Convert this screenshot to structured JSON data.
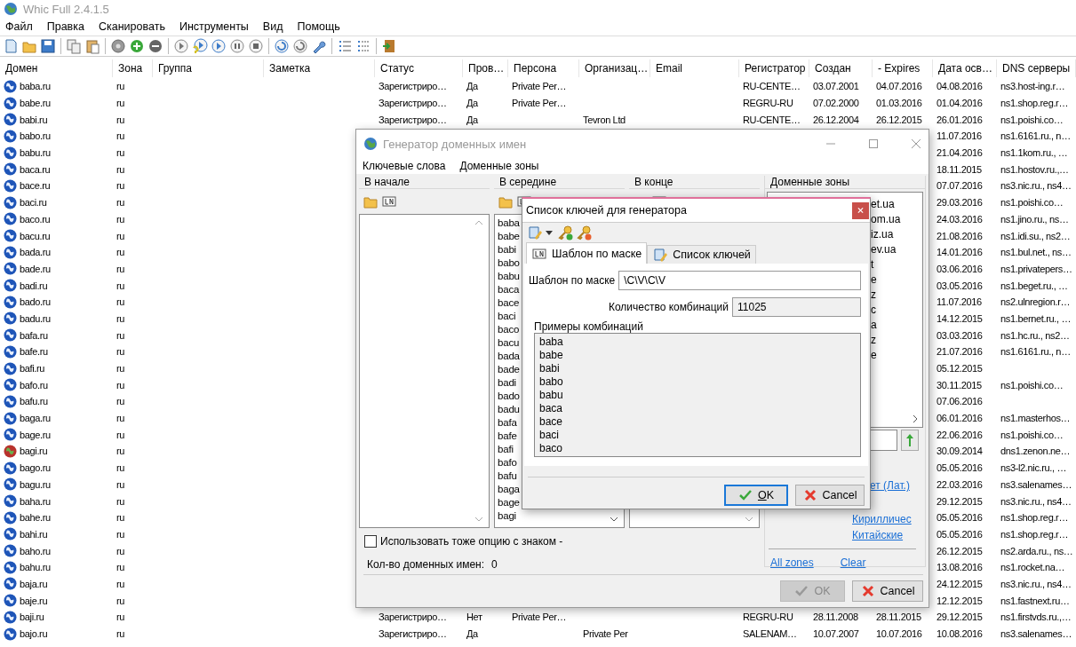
{
  "window": {
    "title": "Whic Full 2.4.1.5"
  },
  "menu": [
    "Файл",
    "Правка",
    "Сканировать",
    "Инструменты",
    "Вид",
    "Помощь"
  ],
  "table": {
    "columns": [
      "Домен",
      "Зона",
      "Группа",
      "Заметка",
      "Статус",
      "Пров…",
      "Персона",
      "Организац…",
      "Email",
      "Регистратор",
      "Создан",
      "- Expires",
      "Дата осв…",
      "DNS серверы"
    ],
    "rows": [
      {
        "kind": "globe",
        "domain": "baba.ru",
        "zone": "ru",
        "status": "Зарегистриро…",
        "checked": "Да",
        "person": "Private Per…",
        "registrar": "RU-CENTE…",
        "created": "03.07.2001",
        "expires": "04.07.2016",
        "freed": "04.08.2016",
        "dns": "ns3.host-ing.r…"
      },
      {
        "kind": "globe",
        "domain": "babe.ru",
        "zone": "ru",
        "status": "Зарегистриро…",
        "checked": "Да",
        "person": "Private Per…",
        "registrar": "REGRU-RU",
        "created": "07.02.2000",
        "expires": "01.03.2016",
        "freed": "01.04.2016",
        "dns": "ns1.shop.reg.r…"
      },
      {
        "kind": "globe",
        "domain": "babi.ru",
        "zone": "ru",
        "status": "Зарегистриро…",
        "checked": "Да",
        "org": "Tevron Ltd",
        "registrar": "RU-CENTE…",
        "created": "26.12.2004",
        "expires": "26.12.2015",
        "freed": "26.01.2016",
        "dns": "ns1.poishi.co…"
      },
      {
        "kind": "globe",
        "domain": "babo.ru",
        "zone": "ru",
        "freed": "11.07.2016",
        "dns": "ns1.6161.ru., n…"
      },
      {
        "kind": "globe",
        "domain": "babu.ru",
        "zone": "ru",
        "freed": "21.04.2016",
        "dns": "ns1.1kom.ru., …"
      },
      {
        "kind": "globe",
        "domain": "baca.ru",
        "zone": "ru",
        "freed": "18.11.2015",
        "dns": "ns1.hostov.ru.,…"
      },
      {
        "kind": "globe",
        "domain": "bace.ru",
        "zone": "ru",
        "freed": "07.07.2016",
        "dns": "ns3.nic.ru., ns4…"
      },
      {
        "kind": "globe",
        "domain": "baci.ru",
        "zone": "ru",
        "freed": "29.03.2016",
        "dns": "ns1.poishi.co…"
      },
      {
        "kind": "globe",
        "domain": "baco.ru",
        "zone": "ru",
        "freed": "24.03.2016",
        "dns": "ns1.jino.ru., ns…"
      },
      {
        "kind": "globe",
        "domain": "bacu.ru",
        "zone": "ru",
        "freed": "21.08.2016",
        "dns": "ns1.idi.su., ns2…"
      },
      {
        "kind": "globe",
        "domain": "bada.ru",
        "zone": "ru",
        "freed": "14.01.2016",
        "dns": "ns1.bul.net., ns…"
      },
      {
        "kind": "globe",
        "domain": "bade.ru",
        "zone": "ru",
        "freed": "03.06.2016",
        "dns": "ns1.privatepers…"
      },
      {
        "kind": "globe",
        "domain": "badi.ru",
        "zone": "ru",
        "freed": "03.05.2016",
        "dns": "ns1.beget.ru., …"
      },
      {
        "kind": "globe",
        "domain": "bado.ru",
        "zone": "ru",
        "freed": "11.07.2016",
        "dns": "ns2.ulnregion.r…"
      },
      {
        "kind": "globe",
        "domain": "badu.ru",
        "zone": "ru",
        "freed": "14.12.2015",
        "dns": "ns1.bernet.ru., …"
      },
      {
        "kind": "globe",
        "domain": "bafa.ru",
        "zone": "ru",
        "freed": "03.03.2016",
        "dns": "ns1.hc.ru., ns2…"
      },
      {
        "kind": "globe",
        "domain": "bafe.ru",
        "zone": "ru",
        "freed": "21.07.2016",
        "dns": "ns1.6161.ru., n…"
      },
      {
        "kind": "globe",
        "domain": "bafi.ru",
        "zone": "ru",
        "freed": "05.12.2015"
      },
      {
        "kind": "globe",
        "domain": "bafo.ru",
        "zone": "ru",
        "freed": "30.11.2015",
        "dns": "ns1.poishi.co…"
      },
      {
        "kind": "globe",
        "domain": "bafu.ru",
        "zone": "ru",
        "freed": "07.06.2016"
      },
      {
        "kind": "globe",
        "domain": "baga.ru",
        "zone": "ru",
        "freed": "06.01.2016",
        "dns": "ns1.masterhos…"
      },
      {
        "kind": "globe",
        "domain": "bage.ru",
        "zone": "ru",
        "freed": "22.06.2016",
        "dns": "ns1.poishi.co…"
      },
      {
        "kind": "alert",
        "domain": "bagi.ru",
        "zone": "ru",
        "freed": "30.09.2014",
        "dns": "dns1.zenon.ne…"
      },
      {
        "kind": "globe",
        "domain": "bago.ru",
        "zone": "ru",
        "freed": "05.05.2016",
        "dns": "ns3-l2.nic.ru., …"
      },
      {
        "kind": "globe",
        "domain": "bagu.ru",
        "zone": "ru",
        "freed": "22.03.2016",
        "dns": "ns3.salenames…"
      },
      {
        "kind": "globe",
        "domain": "baha.ru",
        "zone": "ru",
        "freed": "29.12.2015",
        "dns": "ns3.nic.ru., ns4…"
      },
      {
        "kind": "globe",
        "domain": "bahe.ru",
        "zone": "ru",
        "freed": "05.05.2016",
        "dns": "ns1.shop.reg.r…"
      },
      {
        "kind": "globe",
        "domain": "bahi.ru",
        "zone": "ru",
        "freed": "05.05.2016",
        "dns": "ns1.shop.reg.r…"
      },
      {
        "kind": "globe",
        "domain": "baho.ru",
        "zone": "ru",
        "freed": "26.12.2015",
        "dns": "ns2.arda.ru., ns…"
      },
      {
        "kind": "globe",
        "domain": "bahu.ru",
        "zone": "ru",
        "freed": "13.08.2016",
        "dns": "ns1.rocket.na…"
      },
      {
        "kind": "globe",
        "domain": "baja.ru",
        "zone": "ru",
        "freed": "24.12.2015",
        "dns": "ns3.nic.ru., ns4…"
      },
      {
        "kind": "globe",
        "domain": "baje.ru",
        "zone": "ru",
        "freed": "12.12.2015",
        "dns": "ns1.fastnext.ru…"
      },
      {
        "kind": "globe",
        "domain": "baji.ru",
        "zone": "ru",
        "status": "Зарегистриро…",
        "checked": "Нет",
        "person": "Private Per…",
        "registrar": "REGRU-RU",
        "created": "28.11.2008",
        "expires": "28.11.2015",
        "freed": "29.12.2015",
        "dns": "ns1.firstvds.ru.,…"
      },
      {
        "kind": "globe",
        "domain": "bajo.ru",
        "zone": "ru",
        "status": "Зарегистриро…",
        "checked": "Да",
        "org": "Private Per",
        "registrar": "SALENAM…",
        "created": "10.07.2007",
        "expires": "10.07.2016",
        "freed": "10.08.2016",
        "dns": "ns3.salenames…"
      }
    ]
  },
  "generator": {
    "title": "Генератор доменных имен",
    "menu": [
      "Ключевые слова",
      "Доменные зоны"
    ],
    "groups": [
      {
        "title": "В начале"
      },
      {
        "title": "В середине",
        "items": [
          "baba",
          "babe",
          "babi",
          "babo",
          "babu",
          "baca",
          "bace",
          "baci",
          "baco",
          "bacu",
          "bada",
          "bade",
          "badi",
          "bado",
          "badu",
          "bafa",
          "bafe",
          "bafi",
          "bafo",
          "bafu",
          "baga",
          "bage",
          "bagi"
        ]
      },
      {
        "title": "В конце"
      }
    ],
    "zones": {
      "title": "Доменные зоны",
      "items": [
        "et.ua",
        "om.ua",
        "iz.ua",
        "ev.ua",
        "t",
        "e",
        "z",
        "c",
        "a",
        "z",
        "e"
      ],
      "cut_link": "ет (Лат.)",
      "links": [
        "Кирилличес",
        "Китайские"
      ],
      "bottom_links": [
        "All zones",
        "Clear"
      ]
    },
    "option": {
      "label": "Использовать тоже опцию с знаком -",
      "checked": false
    },
    "count_label": "Кол-во доменных имен:",
    "count": "0",
    "buttons": [
      {
        "kind": "ok",
        "label": "OK",
        "disabled": true
      },
      {
        "kind": "cancel",
        "label": "Cancel",
        "disabled": false
      }
    ]
  },
  "key_dialog": {
    "title": "Список ключей для генератора",
    "tabs": [
      {
        "kind": "mask",
        "label": "Шаблон по маске",
        "selected": true
      },
      {
        "kind": "list",
        "label": "Список ключей",
        "selected": false
      }
    ],
    "mask_label": "Шаблон по маске",
    "mask_value": "\\C\\V\\C\\V",
    "combinations_label": "Количество комбинаций",
    "combinations": "11025",
    "examples_label": "Примеры комбинаций",
    "examples": [
      "baba",
      "babe",
      "babi",
      "babo",
      "babu",
      "baca",
      "bace",
      "baci",
      "baco"
    ],
    "buttons": [
      {
        "kind": "ok",
        "label": "OK",
        "focused": true
      },
      {
        "kind": "cancel",
        "label": "Cancel",
        "focused": false
      }
    ]
  }
}
